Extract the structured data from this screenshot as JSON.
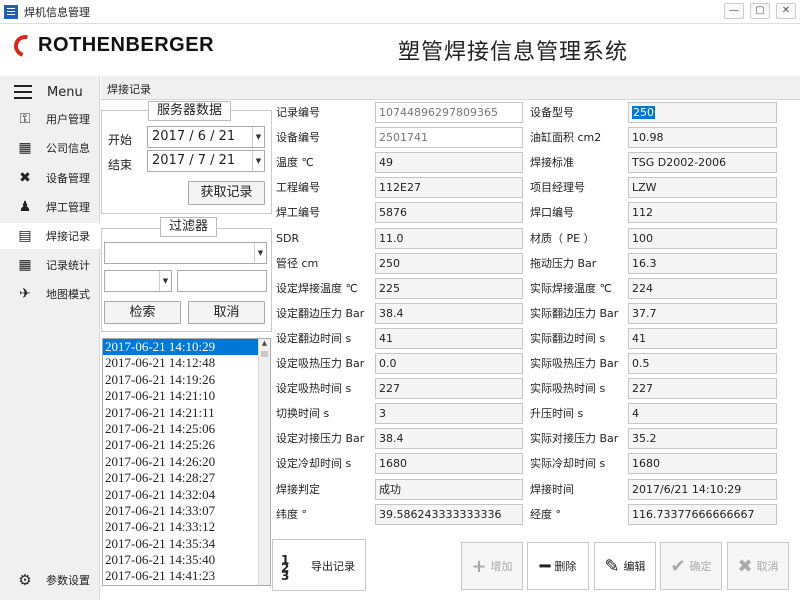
{
  "window": {
    "title": "焊机信息管理",
    "controls": [
      "—",
      "▢",
      "✕"
    ]
  },
  "header": {
    "brand": "ROTHENBERGER",
    "system_title": "塑管焊接信息管理系统"
  },
  "sidebar": {
    "menu_label": "Menu",
    "items": [
      {
        "label": "用户管理",
        "icon": "key-icon"
      },
      {
        "label": "公司信息",
        "icon": "building-icon"
      },
      {
        "label": "设备管理",
        "icon": "tools-icon"
      },
      {
        "label": "焊工管理",
        "icon": "person-icon"
      },
      {
        "label": "焊接记录",
        "icon": "document-icon"
      },
      {
        "label": "记录统计",
        "icon": "calculator-icon"
      },
      {
        "label": "地图模式",
        "icon": "airplane-icon"
      }
    ],
    "settings_label": "参数设置"
  },
  "content": {
    "breadcrumb": "焊接记录"
  },
  "server_panel": {
    "title": "服务器数据",
    "start_label": "开始",
    "start_date": "2017 / 6 / 21",
    "end_label": "结束",
    "end_date": "2017 / 7 / 21",
    "fetch_button": "获取记录"
  },
  "filter_panel": {
    "title": "过滤器",
    "search_button": "检索",
    "cancel_button": "取消"
  },
  "record_list": [
    "2017-06-21 14:10:29",
    "2017-06-21 14:12:48",
    "2017-06-21 14:19:26",
    "2017-06-21 14:21:10",
    "2017-06-21 14:21:11",
    "2017-06-21 14:25:06",
    "2017-06-21 14:25:26",
    "2017-06-21 14:26:20",
    "2017-06-21 14:28:27",
    "2017-06-21 14:32:04",
    "2017-06-21 14:33:07",
    "2017-06-21 14:33:12",
    "2017-06-21 14:35:34",
    "2017-06-21 14:35:40",
    "2017-06-21 14:41:23"
  ],
  "details": {
    "left": [
      {
        "label": "记录编号",
        "value": "10744896297809365"
      },
      {
        "label": "设备编号",
        "value": "2501741"
      },
      {
        "label": "温度 ℃",
        "value": "49"
      },
      {
        "label": "工程编号",
        "value": "112E27"
      },
      {
        "label": "焊工编号",
        "value": "5876"
      },
      {
        "label": "SDR",
        "value": "11.0"
      },
      {
        "label": "管径 cm",
        "value": "250"
      },
      {
        "label": "设定焊接温度 ℃",
        "value": "225"
      },
      {
        "label": "设定翻边压力 Bar",
        "value": "38.4"
      },
      {
        "label": "设定翻边时间 s",
        "value": "41"
      },
      {
        "label": "设定吸热压力 Bar",
        "value": "0.0"
      },
      {
        "label": "设定吸热时间 s",
        "value": "227"
      },
      {
        "label": "切换时间 s",
        "value": "3"
      },
      {
        "label": "设定对接压力 Bar",
        "value": "38.4"
      },
      {
        "label": "设定冷却时间 s",
        "value": "1680"
      },
      {
        "label": "焊接判定",
        "value": "成功"
      },
      {
        "label": "纬度 °",
        "value": "39.586243333333336"
      }
    ],
    "right": [
      {
        "label": "设备型号",
        "value": "250"
      },
      {
        "label": "油缸面积 cm2",
        "value": "10.98"
      },
      {
        "label": "焊接标准",
        "value": "TSG D2002-2006"
      },
      {
        "label": "项目经理号",
        "value": "LZW"
      },
      {
        "label": "焊口编号",
        "value": "112"
      },
      {
        "label": "材质（ PE ）",
        "value": "100"
      },
      {
        "label": "拖动压力 Bar",
        "value": "16.3"
      },
      {
        "label": "实际焊接温度 ℃",
        "value": "224"
      },
      {
        "label": "实际翻边压力 Bar",
        "value": "37.7"
      },
      {
        "label": "实际翻边时间 s",
        "value": "41"
      },
      {
        "label": "实际吸热压力 Bar",
        "value": "0.5"
      },
      {
        "label": "实际吸热时间 s",
        "value": "227"
      },
      {
        "label": "升压时间 s",
        "value": "4"
      },
      {
        "label": "实际对接压力 Bar",
        "value": "35.2"
      },
      {
        "label": "实际冷却时间 s",
        "value": "1680"
      },
      {
        "label": "焊接时间",
        "value": "2017/6/21 14:10:29"
      },
      {
        "label": "经度 °",
        "value": "116.73377666666667"
      }
    ]
  },
  "actions": {
    "export_label": "导出记录",
    "export_icon_lines": [
      "1",
      "2",
      "3"
    ],
    "add_label": "增加",
    "delete_label": "删除",
    "edit_label": "编辑",
    "confirm_label": "确定",
    "cancel_label": "取消"
  }
}
